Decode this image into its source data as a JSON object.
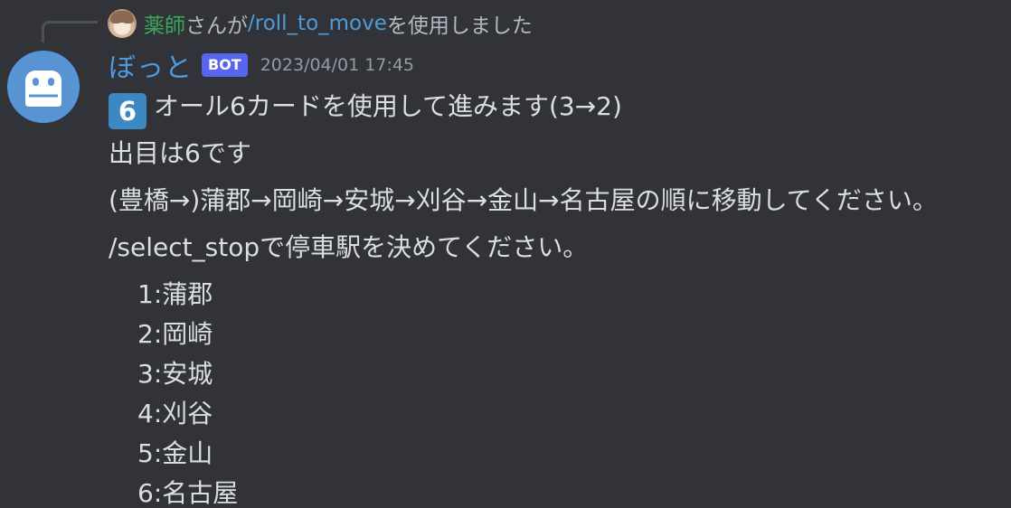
{
  "reply": {
    "user": "薬師",
    "used_prefix": "さんが",
    "command": "/roll_to_move",
    "used_suffix": "を使用しました"
  },
  "author": {
    "name": "ぼっと",
    "badge": "BOT",
    "timestamp": "2023/04/01 17:45"
  },
  "message": {
    "emoji": "6",
    "line1": "オール6カードを使用して進みます(3→2)",
    "line2": "出目は6です",
    "line3": "(豊橋→)蒲郡→岡崎→安城→刈谷→金山→名古屋の順に移動してください。",
    "line4": "/select_stopで停車駅を決めてください。",
    "stops": [
      "1:蒲郡",
      "2:岡崎",
      "3:安城",
      "4:刈谷",
      "5:金山",
      "6:名古屋"
    ]
  },
  "colors": {
    "background": "#313338",
    "username": "#4d9be0",
    "reply_user": "#3ba55c",
    "command_link": "#4f9ad8",
    "badge": "#5865f2",
    "avatar": "#5894d3"
  }
}
